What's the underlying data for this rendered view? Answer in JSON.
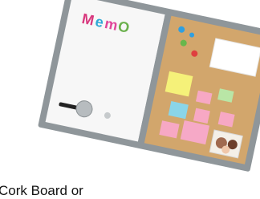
{
  "image": {
    "description_text": {
      "whiteboard_magnet_letters": [
        "M",
        "e",
        "m",
        "O"
      ],
      "whiteboard_magnet_colors": [
        "#d8377d",
        "#2fa8d6",
        "#e0469a",
        "#6ab04c"
      ],
      "frame_color": "#8f969a",
      "cork_color": "#d2a66c",
      "note_colors": [
        "#f5f179",
        "#f7a8c4",
        "#b9e6a6",
        "#8ad5e8"
      ]
    },
    "caption": "Cork Board or"
  }
}
